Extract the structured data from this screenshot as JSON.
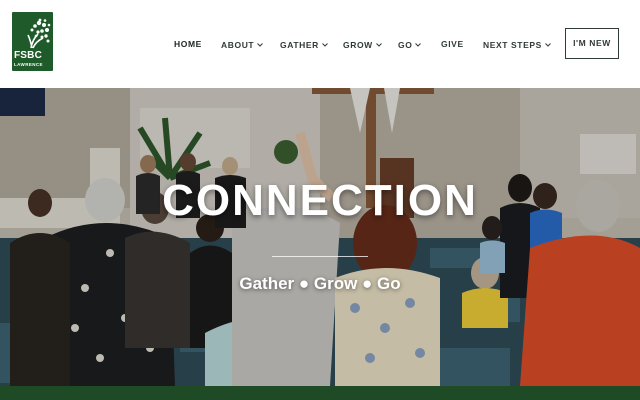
{
  "logo": {
    "name": "FSBC",
    "subtitle": "LAWRENCE",
    "icon": "tree-icon",
    "color": "#1f5a2b"
  },
  "nav": {
    "items": [
      {
        "label": "HOME",
        "dropdown": false,
        "active": true
      },
      {
        "label": "ABOUT",
        "dropdown": true
      },
      {
        "label": "GATHER",
        "dropdown": true
      },
      {
        "label": "GROW",
        "dropdown": true
      },
      {
        "label": "GO",
        "dropdown": true
      },
      {
        "label": "GIVE",
        "dropdown": false
      },
      {
        "label": "NEXT STEPS",
        "dropdown": true
      }
    ],
    "cta_label": "I'M NEW"
  },
  "hero": {
    "title": "CONNECTION",
    "tagline": "Gather ● Grow ● Go"
  },
  "colors": {
    "brand_green": "#1f5a2b",
    "footer_green": "#1e4a25",
    "nav_text": "#2f3b36"
  }
}
